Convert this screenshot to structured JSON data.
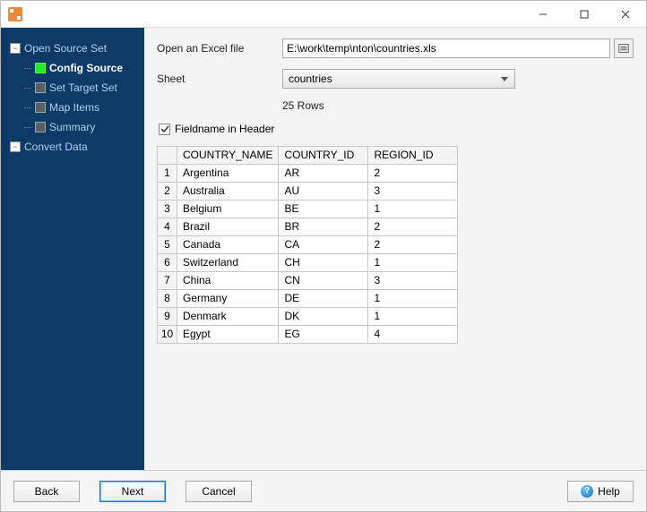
{
  "titlebar": {
    "min": "—",
    "max": "☐",
    "close": "✕"
  },
  "sidebar": {
    "items": [
      {
        "label": "Open Source Set",
        "type": "parent"
      },
      {
        "label": "Config Source",
        "type": "child",
        "active": true
      },
      {
        "label": "Set Target Set",
        "type": "child"
      },
      {
        "label": "Map Items",
        "type": "child"
      },
      {
        "label": "Summary",
        "type": "child"
      },
      {
        "label": "Convert Data",
        "type": "parent"
      }
    ]
  },
  "form": {
    "open_label": "Open an Excel file",
    "file_path": "E:\\work\\temp\\nton\\countries.xls",
    "sheet_label": "Sheet",
    "sheet_value": "countries",
    "row_count": "25 Rows",
    "fieldname_label": "Fieldname in Header",
    "fieldname_checked": true
  },
  "grid": {
    "headers": [
      "COUNTRY_NAME",
      "COUNTRY_ID",
      "REGION_ID"
    ],
    "rows": [
      [
        "Argentina",
        "AR",
        "2"
      ],
      [
        "Australia",
        "AU",
        "3"
      ],
      [
        "Belgium",
        "BE",
        "1"
      ],
      [
        "Brazil",
        "BR",
        "2"
      ],
      [
        "Canada",
        "CA",
        "2"
      ],
      [
        "Switzerland",
        "CH",
        "1"
      ],
      [
        "China",
        "CN",
        "3"
      ],
      [
        "Germany",
        "DE",
        "1"
      ],
      [
        "Denmark",
        "DK",
        "1"
      ],
      [
        "Egypt",
        "EG",
        "4"
      ]
    ]
  },
  "footer": {
    "back": "Back",
    "next": "Next",
    "cancel": "Cancel",
    "help": "Help"
  }
}
